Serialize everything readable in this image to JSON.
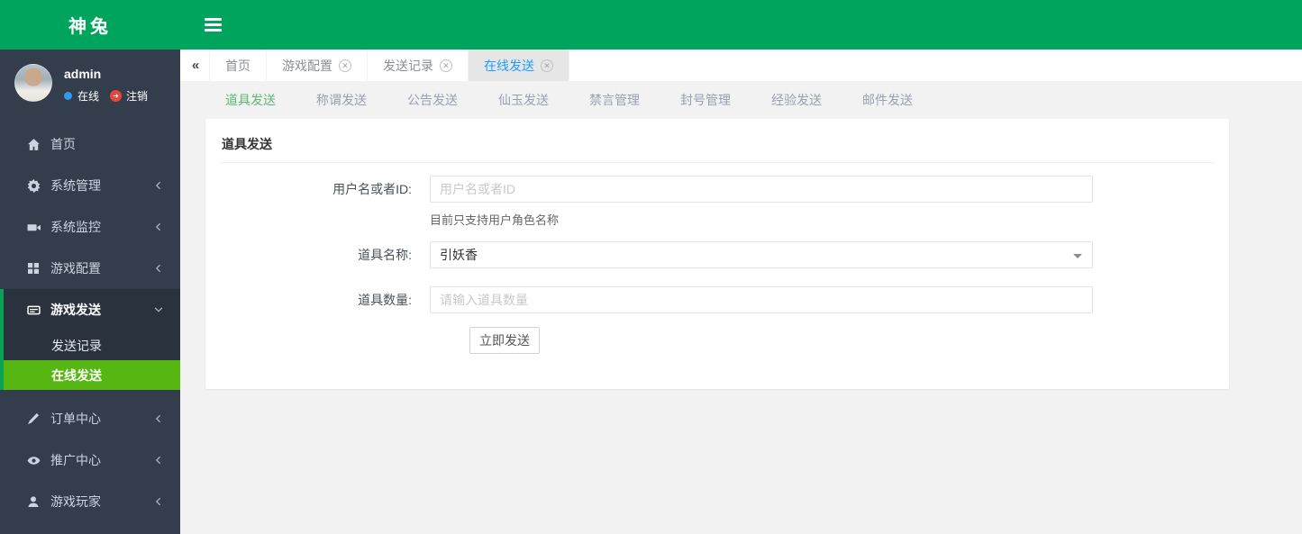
{
  "app": {
    "logo_text": "神兔"
  },
  "colors": {
    "brand_green": "#00A45C",
    "menu_active_green": "#56B712",
    "menu_stripe_green": "#0BA155",
    "tab_active_blue": "#1E9FFF",
    "subtab_active_green": "#5FB878"
  },
  "sidebar": {
    "user": {
      "name": "admin",
      "status_label": "在线",
      "logout_label": "注销"
    },
    "menu": [
      {
        "label": "首页"
      },
      {
        "label": "系统管理"
      },
      {
        "label": "系统监控"
      },
      {
        "label": "游戏配置"
      },
      {
        "label": "游戏发送",
        "children": [
          {
            "label": "发送记录"
          },
          {
            "label": "在线发送"
          }
        ]
      },
      {
        "label": "订单中心"
      },
      {
        "label": "推广中心"
      },
      {
        "label": "游戏玩家"
      }
    ]
  },
  "tabbar": {
    "tabs": [
      {
        "label": "首页"
      },
      {
        "label": "游戏配置"
      },
      {
        "label": "发送记录"
      },
      {
        "label": "在线发送"
      }
    ]
  },
  "subtabs": [
    "道具发送",
    "称谓发送",
    "公告发送",
    "仙玉发送",
    "禁言管理",
    "封号管理",
    "经验发送",
    "邮件发送"
  ],
  "panel": {
    "title": "道具发送",
    "form": {
      "username": {
        "label": "用户名或者ID:",
        "placeholder": "用户名或者ID",
        "help": "目前只支持用户角色名称"
      },
      "item": {
        "label": "道具名称:",
        "value": "引妖香"
      },
      "count": {
        "label": "道具数量:",
        "placeholder": "请输入道具数量"
      },
      "submit_label": "立即发送"
    }
  }
}
